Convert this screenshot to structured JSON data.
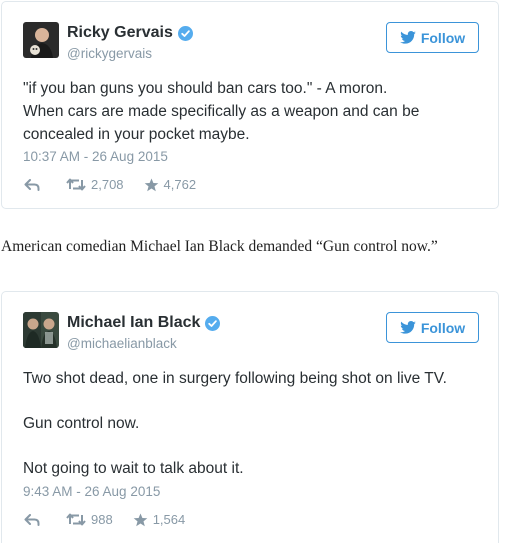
{
  "tweets": [
    {
      "display_name": "Ricky Gervais",
      "handle": "@rickygervais",
      "follow_label": "Follow",
      "text_lines": [
        "\"if you ban guns you should ban cars too.\" - A moron.",
        "When cars are made specifically as a weapon and can be concealed in your pocket maybe."
      ],
      "timestamp": "10:37 AM - 26 Aug 2015",
      "retweets": "2,708",
      "favorites": "4,762"
    },
    {
      "display_name": "Michael Ian Black",
      "handle": "@michaelianblack",
      "follow_label": "Follow",
      "paragraphs": [
        "Two shot dead, one in surgery following being shot on live TV.",
        "Gun control now.",
        "Not going to wait to talk about it."
      ],
      "timestamp": "9:43 AM - 26 Aug 2015",
      "retweets": "988",
      "favorites": "1,564"
    }
  ],
  "caption": "American comedian Michael Ian Black demanded “Gun control now.”",
  "colors": {
    "twitter_blue": "#3b94d9",
    "verified_blue": "#55acee",
    "muted_gray": "#8899a6",
    "text_dark": "#292f33",
    "border": "#e1e8ed"
  },
  "icons": {
    "reply": "reply-icon",
    "retweet": "retweet-icon",
    "favorite": "star-icon",
    "verified": "verified-badge-icon",
    "bird": "twitter-bird-icon"
  }
}
